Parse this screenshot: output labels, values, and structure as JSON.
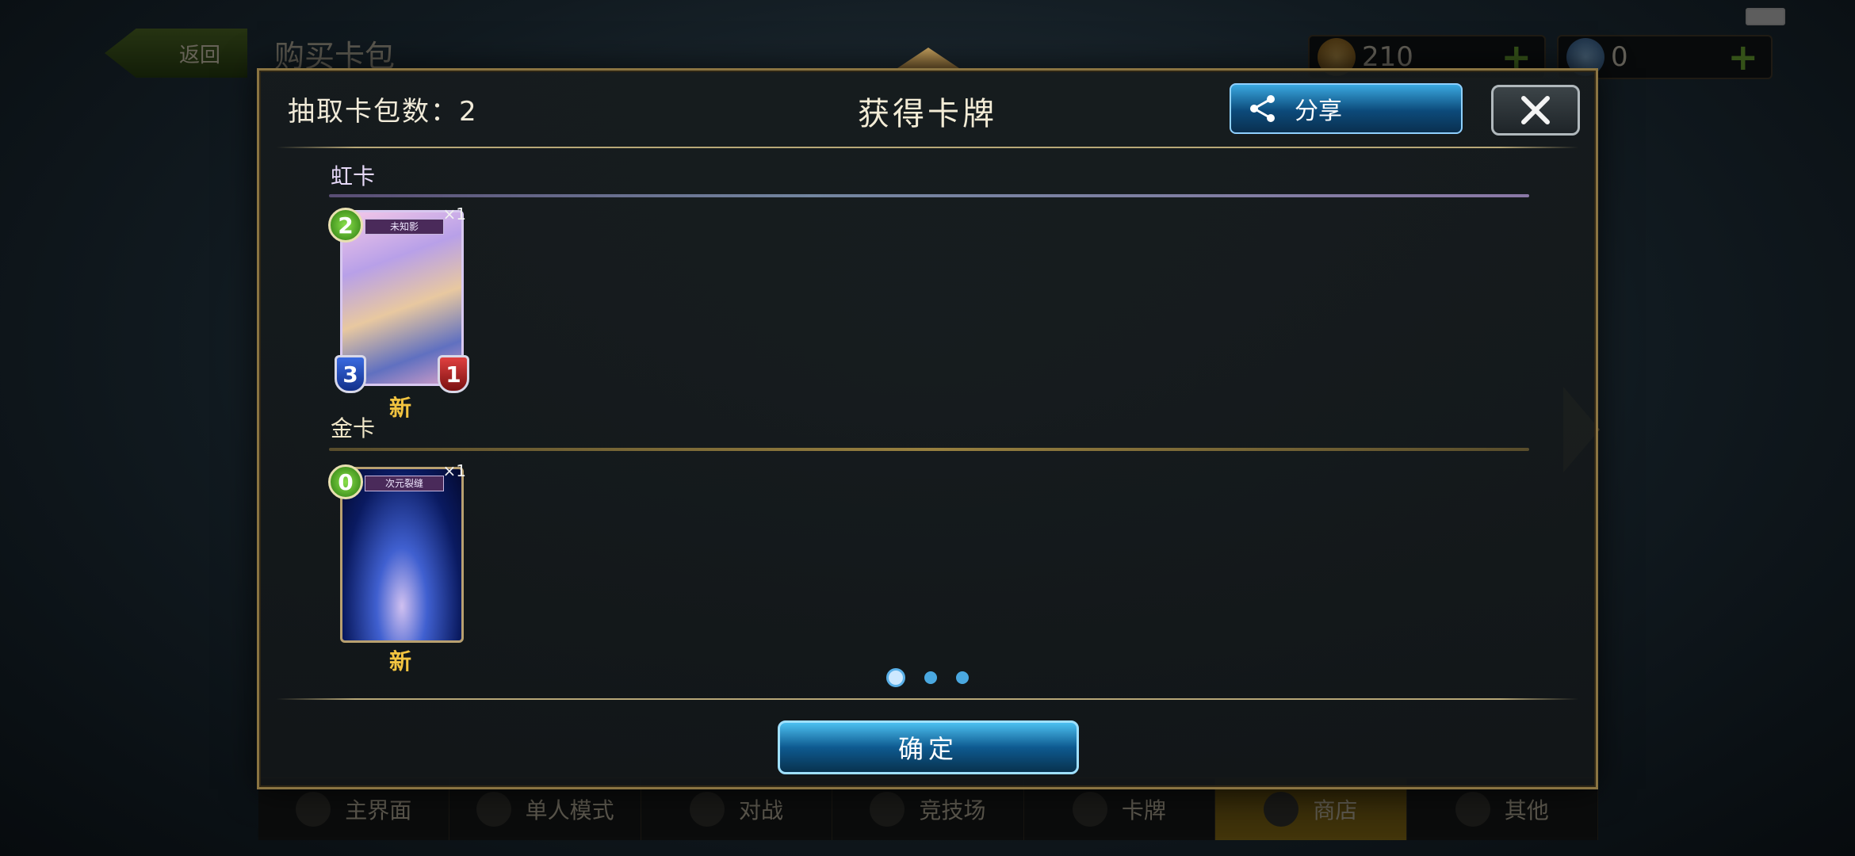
{
  "background": {
    "back_label": "返回",
    "page_title": "购买卡包",
    "gold_amount": "210",
    "crystal_amount": "0",
    "nav_items": [
      "主界面",
      "单人模式",
      "对战",
      "竞技场",
      "卡牌",
      "商店",
      "其他"
    ],
    "active_nav": "商店"
  },
  "modal": {
    "packs_drawn_label": "抽取卡包数：2",
    "title": "获得卡牌",
    "share_label": "分享",
    "sections": [
      {
        "label": "虹卡",
        "cards": [
          {
            "name": "未知影",
            "cost": "2",
            "attack": "3",
            "defense": "1",
            "quantity": "×1",
            "new_label": "新"
          }
        ]
      },
      {
        "label": "金卡",
        "cards": [
          {
            "name": "次元裂缝",
            "cost": "0",
            "quantity": "×1",
            "new_label": "新"
          }
        ]
      }
    ],
    "pagination": {
      "current": 1,
      "total": 3
    },
    "confirm_label": "确定"
  },
  "colors": {
    "accent_blue": "#0e5a90",
    "frame_gold": "#8a7442",
    "new_tag": "#f2c440",
    "cost_gem": "#2a7a10"
  }
}
